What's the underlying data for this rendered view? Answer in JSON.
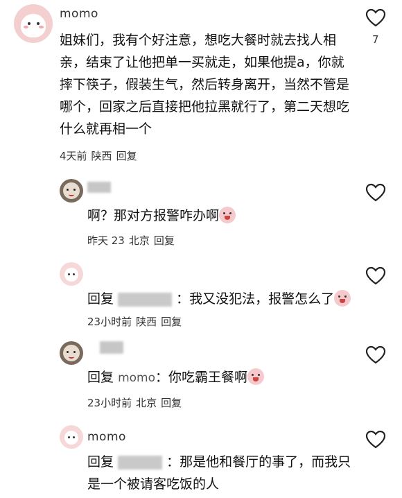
{
  "main_comment": {
    "username": "momo",
    "text": "姐妹们，我有个好注意，想吃大餐时就去找人相亲，结束了让他把单一买就走，如果他提a，你就摔下筷子，假装生气，然后转身离开，当然不管是哪个，回家之后直接把他拉黑就行了，第二天想吃什么就再相一个",
    "time": "4天前",
    "location": "陕西",
    "reply_label": "回复",
    "likes": "7"
  },
  "replies": [
    {
      "text": "啊？那对方报警咋办啊",
      "time": "昨天 23",
      "location": "北京",
      "reply_label": "回复"
    },
    {
      "prefix": "回复",
      "text": "：我又没犯法，报警怎么了",
      "time": "23小时前",
      "location": "陕西",
      "reply_label": "回复"
    },
    {
      "prefix": "回复",
      "target": "momo",
      "text": "：你吃霸王餐啊",
      "time": "23小时前",
      "location": "北京",
      "reply_label": "回复"
    },
    {
      "username": "momo",
      "prefix": "回复",
      "text": "：那是他和餐厅的事了，而我只是一个被请客吃饭的人"
    }
  ],
  "icons": {
    "like": "heart-outline-icon"
  }
}
